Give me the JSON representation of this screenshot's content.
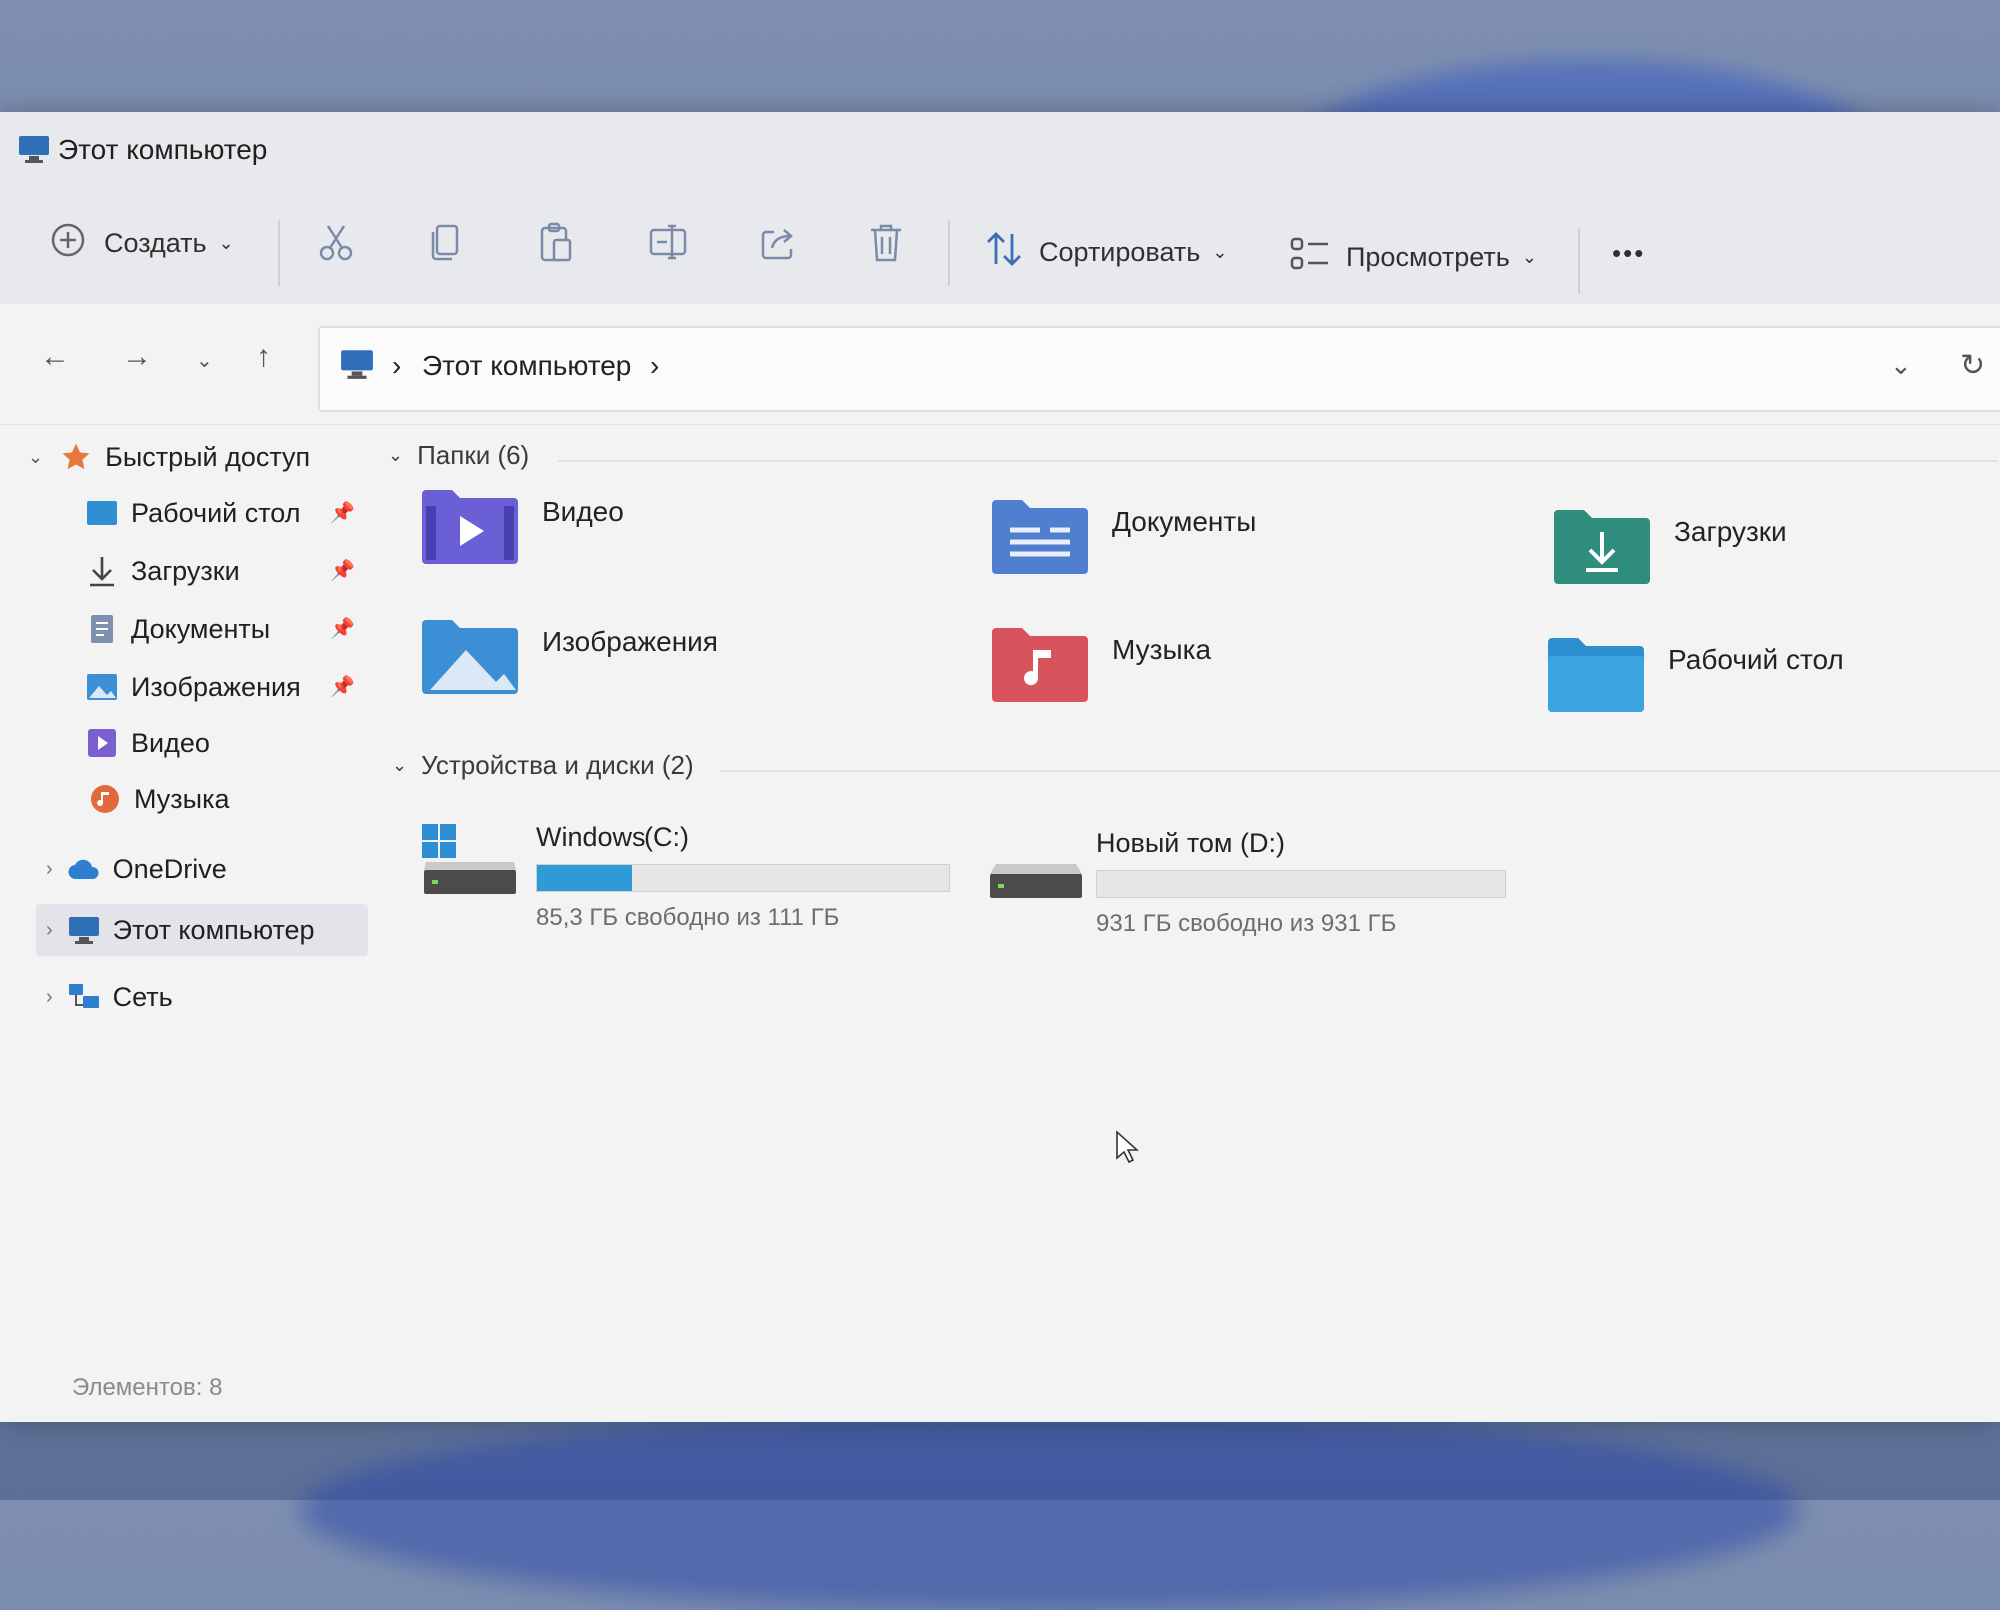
{
  "window": {
    "title": "Этот компьютер"
  },
  "toolbar": {
    "new_label": "Создать",
    "sort_label": "Сортировать",
    "view_label": "Просмотреть",
    "more_label": "•••"
  },
  "address": {
    "crumb_this_pc": "Этот компьютер",
    "separator": "›"
  },
  "sidebar": {
    "quick_access": "Быстрый доступ",
    "items": [
      {
        "label": "Рабочий стол",
        "icon": "desktop-icon",
        "pinned": true
      },
      {
        "label": "Загрузки",
        "icon": "download-icon",
        "pinned": true
      },
      {
        "label": "Документы",
        "icon": "documents-icon",
        "pinned": true
      },
      {
        "label": "Изображения",
        "icon": "pictures-icon",
        "pinned": true
      },
      {
        "label": "Видео",
        "icon": "video-icon",
        "pinned": false
      },
      {
        "label": "Музыка",
        "icon": "music-icon",
        "pinned": false
      }
    ],
    "onedrive": "OneDrive",
    "this_pc": "Этот компьютер",
    "network": "Сеть"
  },
  "folders_section": {
    "title": "Папки (6)",
    "items": [
      {
        "label": "Видео",
        "color": "#6b5fd6"
      },
      {
        "label": "Документы",
        "color": "#4f7fce"
      },
      {
        "label": "Загрузки",
        "color": "#2f8d7e"
      },
      {
        "label": "Изображения",
        "color": "#3c8fd4"
      },
      {
        "label": "Музыка",
        "color": "#d9535c"
      },
      {
        "label": "Рабочий стол",
        "color": "#2e8fd0"
      }
    ]
  },
  "drives_section": {
    "title": "Устройства и диски (2)",
    "drives": [
      {
        "label": "Windows",
        "letter": "(C:)",
        "free_text": "85,3 ГБ свободно из 111 ГБ",
        "used_fraction": 0.23,
        "bar_color": "#2f9bd6"
      },
      {
        "label": "Новый том (D:)",
        "letter": "",
        "free_text": "931 ГБ свободно из 931 ГБ",
        "used_fraction": 0.0,
        "bar_color": "#2f9bd6"
      }
    ]
  },
  "status": {
    "items_count": "Элементов: 8"
  }
}
